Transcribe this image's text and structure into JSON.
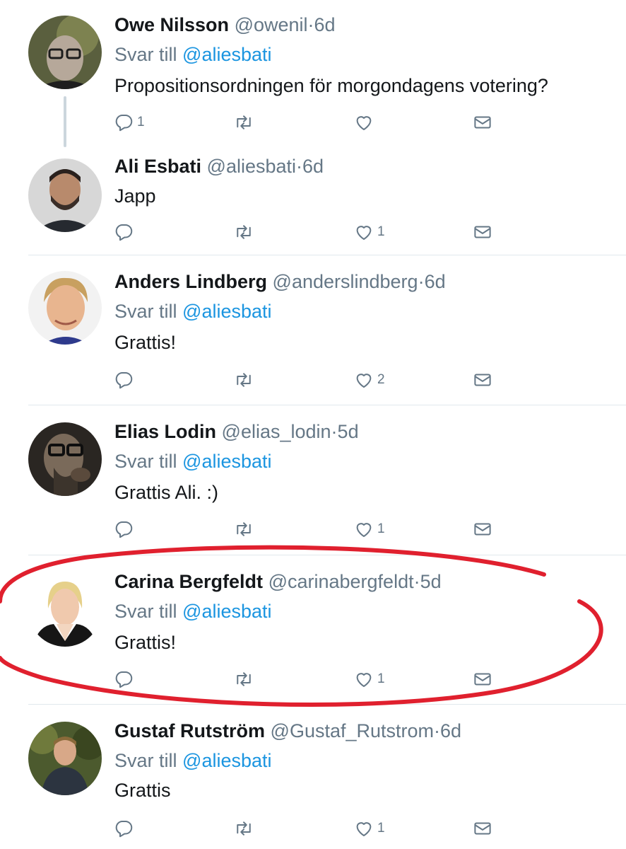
{
  "tweets": [
    {
      "name": "Owe Nilsson",
      "handle": "@owenil",
      "separator": "·",
      "time": "6d",
      "reply_prefix": "Svar till",
      "reply_to": "@aliesbati",
      "text": "Propositionsordningen för morgondagens votering?",
      "reply_count": "1",
      "retweet_count": "",
      "like_count": ""
    },
    {
      "name": "Ali Esbati",
      "handle": "@aliesbati",
      "separator": "·",
      "time": "6d",
      "text": "Japp",
      "reply_count": "",
      "retweet_count": "",
      "like_count": "1"
    },
    {
      "name": "Anders Lindberg",
      "handle": "@anderslindberg",
      "separator": "·",
      "time": "6d",
      "reply_prefix": "Svar till",
      "reply_to": "@aliesbati",
      "text": "Grattis!",
      "reply_count": "",
      "retweet_count": "",
      "like_count": "2"
    },
    {
      "name": "Elias Lodin",
      "handle": "@elias_lodin",
      "separator": "·",
      "time": "5d",
      "reply_prefix": "Svar till",
      "reply_to": "@aliesbati",
      "text": "Grattis Ali. :)",
      "reply_count": "",
      "retweet_count": "",
      "like_count": "1"
    },
    {
      "name": "Carina Bergfeldt",
      "handle": "@carinabergfeldt",
      "separator": "·",
      "time": "5d",
      "reply_prefix": "Svar till",
      "reply_to": "@aliesbati",
      "text": "Grattis!",
      "reply_count": "",
      "retweet_count": "",
      "like_count": "1"
    },
    {
      "name": "Gustaf Rutström",
      "handle": "@Gustaf_Rutstrom",
      "separator": "·",
      "time": "6d",
      "reply_prefix": "Svar till",
      "reply_to": "@aliesbati",
      "text": "Grattis",
      "reply_count": "",
      "retweet_count": "",
      "like_count": "1"
    }
  ],
  "icons": {
    "reply": "reply-icon",
    "retweet": "retweet-icon",
    "like": "heart-icon",
    "message": "envelope-icon"
  },
  "colors": {
    "mention": "#1b95e0",
    "secondary_text": "#657786",
    "annotation": "#e0202e"
  }
}
